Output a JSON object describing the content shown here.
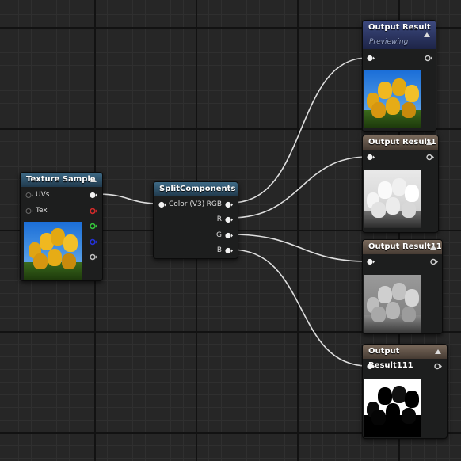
{
  "texture_sample": {
    "title": "Texture Sample",
    "inputs": [
      "UVs",
      "Tex"
    ]
  },
  "split_components": {
    "title": "SplitComponents",
    "input": "Color (V3)",
    "outputs": [
      "RGB",
      "R",
      "G",
      "B"
    ]
  },
  "output_nodes": [
    {
      "title": "Output Result",
      "subtitle": "Previewing",
      "preview": "color"
    },
    {
      "title": "Output Result1",
      "preview": "red-channel"
    },
    {
      "title": "Output Result11",
      "preview": "green-channel"
    },
    {
      "title": "Output Result111",
      "preview": "blue-channel"
    }
  ],
  "colors": {
    "pin_red": "#d12a2a",
    "pin_green": "#35c43a",
    "pin_blue": "#2432d8",
    "wire": "#dcdcdc",
    "header_texture": "#2f5670",
    "header_output": "#645448",
    "header_preview": "#2f3a66"
  }
}
